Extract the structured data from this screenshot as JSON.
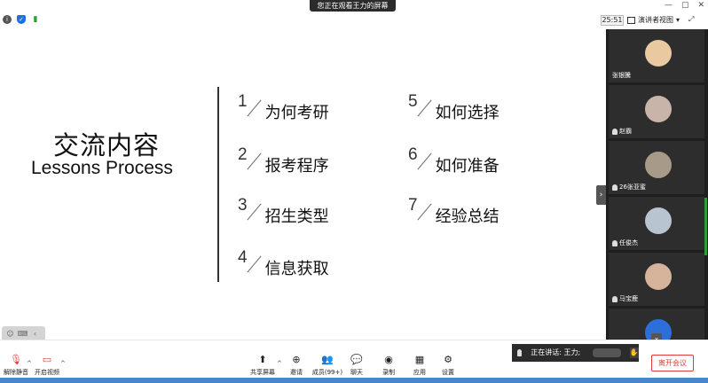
{
  "top": {
    "share_banner": "您正在观看王力的屏幕",
    "window_controls": [
      "—",
      "▢",
      "✕"
    ],
    "status_icons": [
      "info-icon",
      "shield-icon",
      "signal-icon"
    ],
    "timer": "25:51",
    "view_mode": "演讲者视图",
    "right_controls": [
      "▾",
      "⤢"
    ]
  },
  "slide": {
    "title_cn": "交流内容",
    "title_en": "Lessons Process",
    "lessons": [
      {
        "num": "1",
        "text": "为何考研"
      },
      {
        "num": "2",
        "text": "报考程序"
      },
      {
        "num": "3",
        "text": "招生类型"
      },
      {
        "num": "4",
        "text": "信息获取"
      },
      {
        "num": "5",
        "text": "如何选择"
      },
      {
        "num": "6",
        "text": "如何准备"
      },
      {
        "num": "7",
        "text": "经验总结"
      }
    ],
    "toolbar_icons": [
      "☺",
      "⌨",
      "‹"
    ]
  },
  "side_toggle": "›",
  "participants": [
    {
      "name": "张银騰",
      "avatar_color": "#e8c9a0"
    },
    {
      "name": "赵霸",
      "avatar_color": "#c8b4a8"
    },
    {
      "name": "26张亚蜜",
      "avatar_color": "#a89a88"
    },
    {
      "name": "任俊杰",
      "avatar_color": "#b8c4d0"
    },
    {
      "name": "马宝鹿",
      "avatar_color": "#d6b49c"
    },
    {
      "name": "",
      "avatar_color": "#2d6fd8"
    }
  ],
  "gallery_down": "⌄",
  "bottom": {
    "unmute": "解除静音",
    "start_video": "开启视频",
    "share_screen": "共享屏幕",
    "invite": "邀请",
    "members": "成员(99+)",
    "chat": "聊天",
    "record": "录制",
    "apps": "应用",
    "settings": "设置",
    "caret": "^",
    "speaking": "正在讲话: 王力;",
    "leave": "离开会议"
  }
}
